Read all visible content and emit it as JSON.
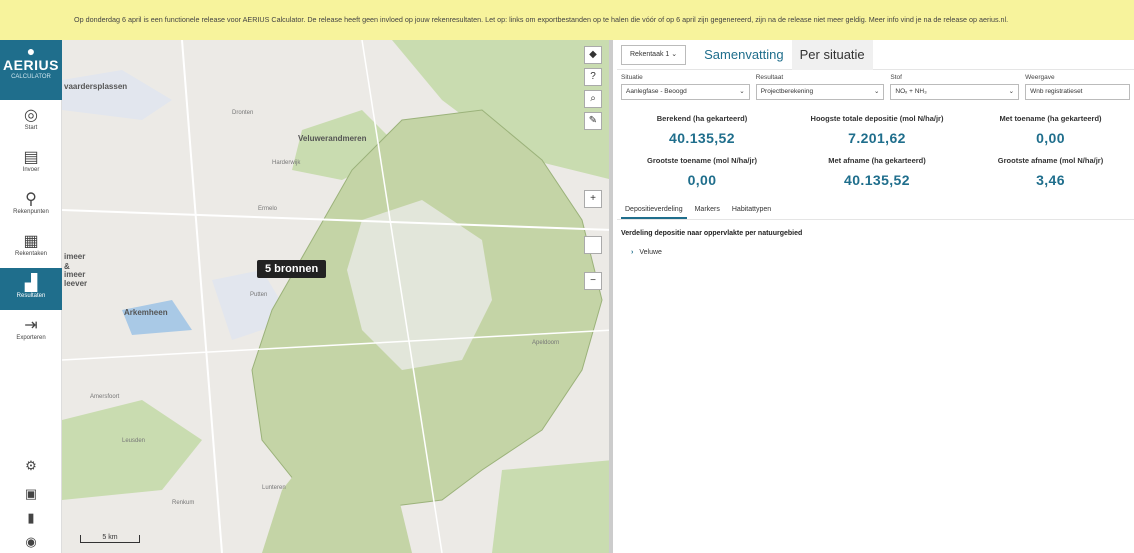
{
  "banner": {
    "text": "Op donderdag 6 april is een functionele release voor AERIUS Calculator. De release heeft geen invloed op jouw rekenresultaten. Let op: links om exportbestanden op te halen die vóór of op 6 april zijn gegenereerd, zijn na de release niet meer geldig. Meer info vind je na de release op aerius.nl."
  },
  "logo": {
    "name": "AERIUS",
    "sub": "CALCULATOR"
  },
  "nav": [
    {
      "label": "Start",
      "icon": "◎"
    },
    {
      "label": "Invoer",
      "icon": "▤"
    },
    {
      "label": "Rekenpunten",
      "icon": "⚲"
    },
    {
      "label": "Rekentaken",
      "icon": "▦"
    },
    {
      "label": "Resultaten",
      "icon": "▟"
    },
    {
      "label": "Exporteren",
      "icon": "⇥"
    }
  ],
  "map": {
    "labels": [
      "vaardersplassen",
      "Veluwerandmeren",
      "Arkemheen",
      "imeer",
      "&",
      "imeer",
      "leever",
      "Dronten",
      "Harderwijk",
      "Ermelo",
      "Putten",
      "Apeldoorn",
      "Amersfoort",
      "Leusden",
      "Renkum",
      "Lunteren"
    ],
    "tooltip": "5 bronnen",
    "scale": "5 km"
  },
  "panel": {
    "rektaak": "Rekentaak 1",
    "tabs": [
      "Samenvatting",
      "Per situatie"
    ],
    "filters": [
      {
        "label": "Situatie",
        "value": "Aanlegfase - Beoogd"
      },
      {
        "label": "Resultaat",
        "value": "Projectberekening"
      },
      {
        "label": "Stof",
        "value": "NOₓ + NH₃"
      },
      {
        "label": "Weergave",
        "value": "Wnb registratieset"
      }
    ],
    "stats": [
      {
        "label": "Berekend (ha gekarteerd)",
        "value": "40.135,52"
      },
      {
        "label": "Hoogste totale depositie (mol N/ha/jr)",
        "value": "7.201,62"
      },
      {
        "label": "Met toename (ha gekarteerd)",
        "value": "0,00"
      },
      {
        "label": "Grootste toename (mol N/ha/jr)",
        "value": "0,00"
      },
      {
        "label": "Met afname (ha gekarteerd)",
        "value": "40.135,52"
      },
      {
        "label": "Grootste afname (mol N/ha/jr)",
        "value": "3,46"
      }
    ],
    "subtabs": [
      "Depositieverdeling",
      "Markers",
      "Habitattypen"
    ],
    "section_title": "Verdeling depositie naar oppervlakte per natuurgebied",
    "tree_item": "Veluwe"
  }
}
